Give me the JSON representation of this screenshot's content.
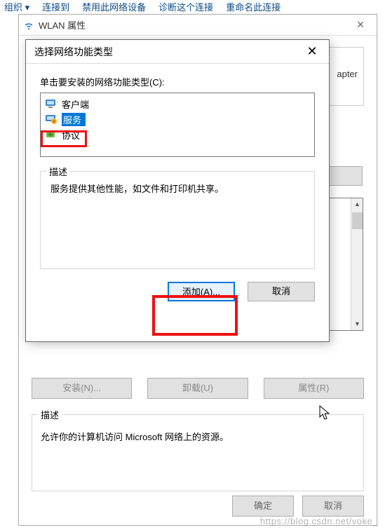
{
  "bg_toolbar": {
    "org": "组织 ▾",
    "connect": "连接到",
    "disable": "禁用此网络设备",
    "diagnose": "诊断这个连接",
    "rename": "重命名此连接"
  },
  "wlan": {
    "title": "WLAN 属性",
    "apter_fragment": "apter",
    "config_btn": "...",
    "install_btn": "安装(N)...",
    "uninstall_btn": "卸载(U)",
    "props_btn": "属性(R)",
    "desc_legend": "描述",
    "desc_text": "允许你的计算机访问 Microsoft 网络上的资源。",
    "ok_btn": "确定",
    "cancel_btn": "取消"
  },
  "type_dlg": {
    "title": "选择网络功能类型",
    "prompt": "单击要安装的网络功能类型(C):",
    "items": [
      {
        "icon": "client-icon",
        "label": "客户端"
      },
      {
        "icon": "service-icon",
        "label": "服务"
      },
      {
        "icon": "protocol-icon",
        "label": "协议"
      }
    ],
    "selected_index": 1,
    "desc_legend": "描述",
    "desc_text": "服务提供其他性能，如文件和打印机共享。",
    "add_btn": "添加(A)...",
    "cancel_btn": "取消"
  },
  "watermark": "https://blog.csdn.net/voke_"
}
